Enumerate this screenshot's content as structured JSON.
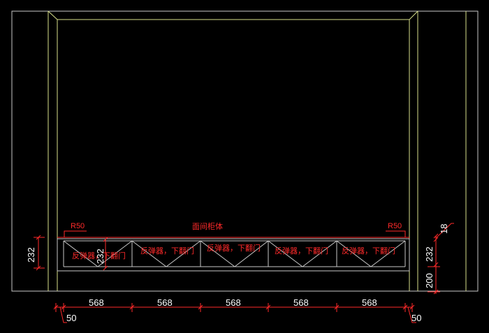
{
  "drawing": {
    "colors": {
      "background": "#000000",
      "outline": "#c8c8c8",
      "frame": "#d8e08a",
      "cabinet": "#c7c7c7",
      "annotation": "#ff2a2a",
      "dimension_text": "#ffffff"
    },
    "labels": {
      "top_note": "面间柜体",
      "radius_left": "R50",
      "radius_right": "R50",
      "panel_1": "反弹器，下翻门",
      "panel_2": "反弹器，下翻门",
      "panel_3": "反弹器，下翻门",
      "panel_4": "反弹器，下翻门",
      "panel_5": "反弹器，下翻门"
    },
    "dimensions": {
      "bottom_widths": [
        "568",
        "568",
        "568",
        "568",
        "568"
      ],
      "offset_left": "50",
      "offset_right": "50",
      "left_height": "232",
      "center_height": "232",
      "right_upper": "18",
      "right_middle": "232",
      "right_lower": "200"
    }
  }
}
